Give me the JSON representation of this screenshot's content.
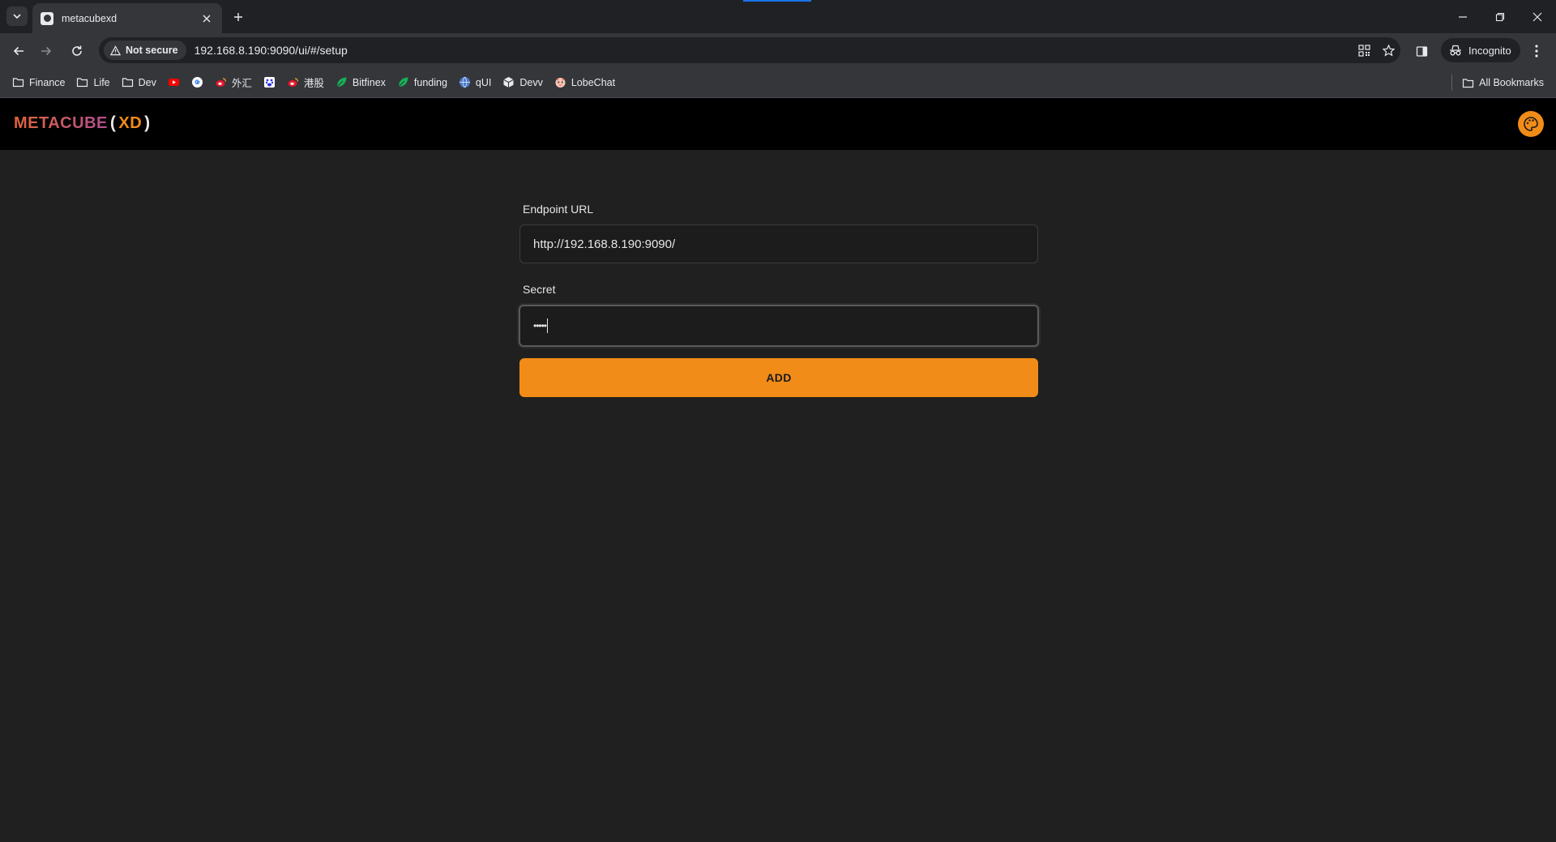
{
  "browser": {
    "tab_title": "metacubexd",
    "security_label": "Not secure",
    "url": "192.168.8.190:9090/ui/#/setup",
    "profile_label": "Incognito",
    "bookmarks": [
      {
        "label": "Finance",
        "icon": "folder-icon"
      },
      {
        "label": "Life",
        "icon": "folder-icon"
      },
      {
        "label": "Dev",
        "icon": "folder-icon"
      },
      {
        "label": "",
        "icon": "youtube-icon"
      },
      {
        "label": "",
        "icon": "google-icon"
      },
      {
        "label": "外汇",
        "icon": "weibo-icon"
      },
      {
        "label": "",
        "icon": "baidu-icon"
      },
      {
        "label": "港股",
        "icon": "weibo-icon"
      },
      {
        "label": "Bitfinex",
        "icon": "leaf-icon"
      },
      {
        "label": "funding",
        "icon": "leaf-icon"
      },
      {
        "label": "qUI",
        "icon": "globe-icon"
      },
      {
        "label": "Devv",
        "icon": "cube-icon"
      },
      {
        "label": "LobeChat",
        "icon": "lobechat-icon"
      }
    ],
    "all_bookmarks_label": "All Bookmarks"
  },
  "app": {
    "logo_main": "METACUBE",
    "logo_open": "(",
    "logo_xd": "XD",
    "logo_close": ")",
    "endpoint_label": "Endpoint URL",
    "endpoint_value": "http://192.168.8.190:9090/",
    "secret_label": "Secret",
    "secret_value": "•••••",
    "add_label": "ADD"
  },
  "colors": {
    "accent": "#f28c18",
    "background": "#202020",
    "header": "#000000"
  }
}
